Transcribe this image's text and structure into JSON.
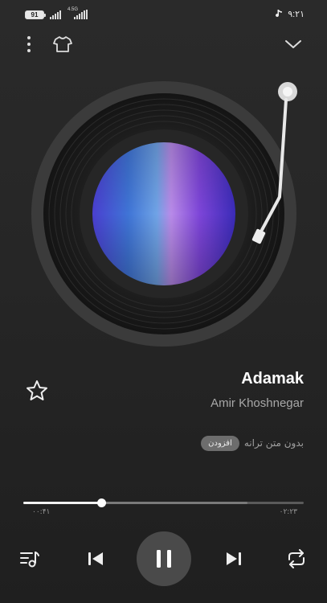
{
  "status_bar": {
    "battery": "91",
    "network": "4.5G",
    "time": "۹:۲۱",
    "icons": [
      "battery-icon",
      "signal-icon",
      "signal-icon",
      "tiktok-note-icon"
    ]
  },
  "header": {
    "icons": [
      "more-vertical-icon",
      "shirt-icon",
      "chevron-down-icon"
    ]
  },
  "now_playing": {
    "title": "Adamak",
    "artist": "Amir Khoshnegar",
    "favorite_icon": "star-icon"
  },
  "lyrics": {
    "text": "بدون متن ترانه",
    "badge": "افزودن"
  },
  "progress": {
    "elapsed": "۰۰:۴۱",
    "total": "۰۲:۲۳",
    "fraction": 0.278,
    "buffered_fraction": 0.8
  },
  "controls": {
    "icons": [
      "playlist-icon",
      "previous-icon",
      "pause-icon",
      "next-icon",
      "repeat-icon"
    ]
  },
  "colors": {
    "background": "#262626",
    "accent": "#ffffff",
    "badge_bg": "#6d6d6d"
  }
}
